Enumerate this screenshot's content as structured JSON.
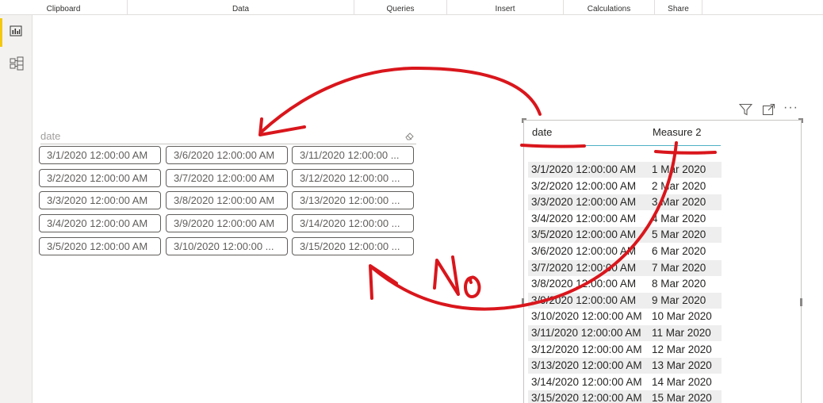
{
  "ribbon": {
    "groups": [
      "Clipboard",
      "Data",
      "Queries",
      "Insert",
      "Calculations",
      "Share"
    ]
  },
  "rail": {
    "items": [
      {
        "icon": "report-view-icon",
        "active": true
      },
      {
        "icon": "model-view-icon",
        "active": false
      }
    ],
    "accent": "#f2c811"
  },
  "slicer": {
    "title": "date",
    "items": [
      "3/1/2020 12:00:00 AM",
      "3/6/2020 12:00:00 AM",
      "3/11/2020 12:00:00 ...",
      "3/2/2020 12:00:00 AM",
      "3/7/2020 12:00:00 AM",
      "3/12/2020 12:00:00 ...",
      "3/3/2020 12:00:00 AM",
      "3/8/2020 12:00:00 AM",
      "3/13/2020 12:00:00 ...",
      "3/4/2020 12:00:00 AM",
      "3/9/2020 12:00:00 AM",
      "3/14/2020 12:00:00 ...",
      "3/5/2020 12:00:00 AM",
      "3/10/2020 12:00:00 ...",
      "3/15/2020 12:00:00 ..."
    ]
  },
  "table": {
    "columns": [
      "date",
      "Measure 2"
    ],
    "rows": [
      [
        "3/1/2020 12:00:00 AM",
        "1 Mar 2020"
      ],
      [
        "3/2/2020 12:00:00 AM",
        "2 Mar 2020"
      ],
      [
        "3/3/2020 12:00:00 AM",
        "3 Mar 2020"
      ],
      [
        "3/4/2020 12:00:00 AM",
        "4 Mar 2020"
      ],
      [
        "3/5/2020 12:00:00 AM",
        "5 Mar 2020"
      ],
      [
        "3/6/2020 12:00:00 AM",
        "6 Mar 2020"
      ],
      [
        "3/7/2020 12:00:00 AM",
        "7 Mar 2020"
      ],
      [
        "3/8/2020 12:00:00 AM",
        "8 Mar 2020"
      ],
      [
        "3/9/2020 12:00:00 AM",
        "9 Mar 2020"
      ],
      [
        "3/10/2020 12:00:00 AM",
        "10 Mar 2020"
      ],
      [
        "3/11/2020 12:00:00 AM",
        "11 Mar 2020"
      ],
      [
        "3/12/2020 12:00:00 AM",
        "12 Mar 2020"
      ],
      [
        "3/13/2020 12:00:00 AM",
        "13 Mar 2020"
      ],
      [
        "3/14/2020 12:00:00 AM",
        "14 Mar 2020"
      ],
      [
        "3/15/2020 12:00:00 AM",
        "15 Mar 2020"
      ]
    ],
    "header_accent": "#4fb0c6",
    "stripe_color": "#eeeeee"
  },
  "visual_toolbar": {
    "icons": [
      "filter-icon",
      "focus-mode-icon",
      "more-options-icon"
    ],
    "more_glyph": "···"
  },
  "annotation": {
    "text": "No",
    "ink_color": "#d9161c"
  }
}
